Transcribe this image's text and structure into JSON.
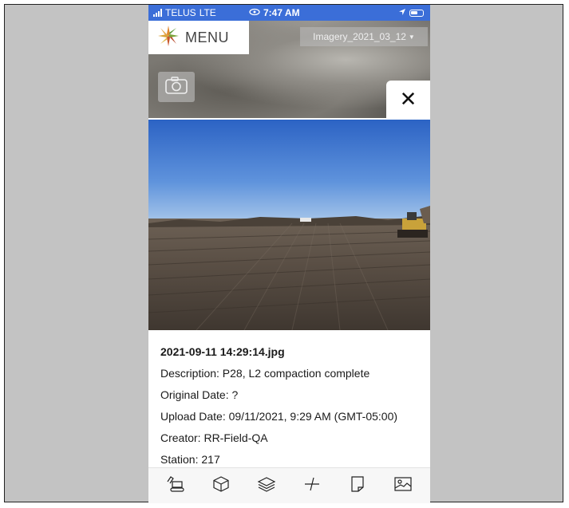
{
  "status_bar": {
    "carrier": "TELUS",
    "network": "LTE",
    "time": "7:47 AM"
  },
  "header": {
    "menu_label": "MENU",
    "imagery_selector": "Imagery_2021_03_12",
    "close_symbol": "✕"
  },
  "photo": {
    "filename": "2021-09-11 14:29:14.jpg",
    "description": "Description: P28, L2 compaction complete",
    "original_date": "Original Date: ?",
    "upload_date": "Upload Date: 09/11/2021, 9:29 AM (GMT-05:00)",
    "creator": "Creator: RR-Field-QA",
    "station": "Station: 217"
  },
  "tabbar": {
    "icons": [
      "excavator-icon",
      "cube-icon",
      "layers-icon",
      "measure-icon",
      "document-icon",
      "image-icon"
    ]
  },
  "colors": {
    "status_bar": "#3b6ed8",
    "frame_background": "#c3c3c3",
    "panel_background": "#ffffff"
  }
}
